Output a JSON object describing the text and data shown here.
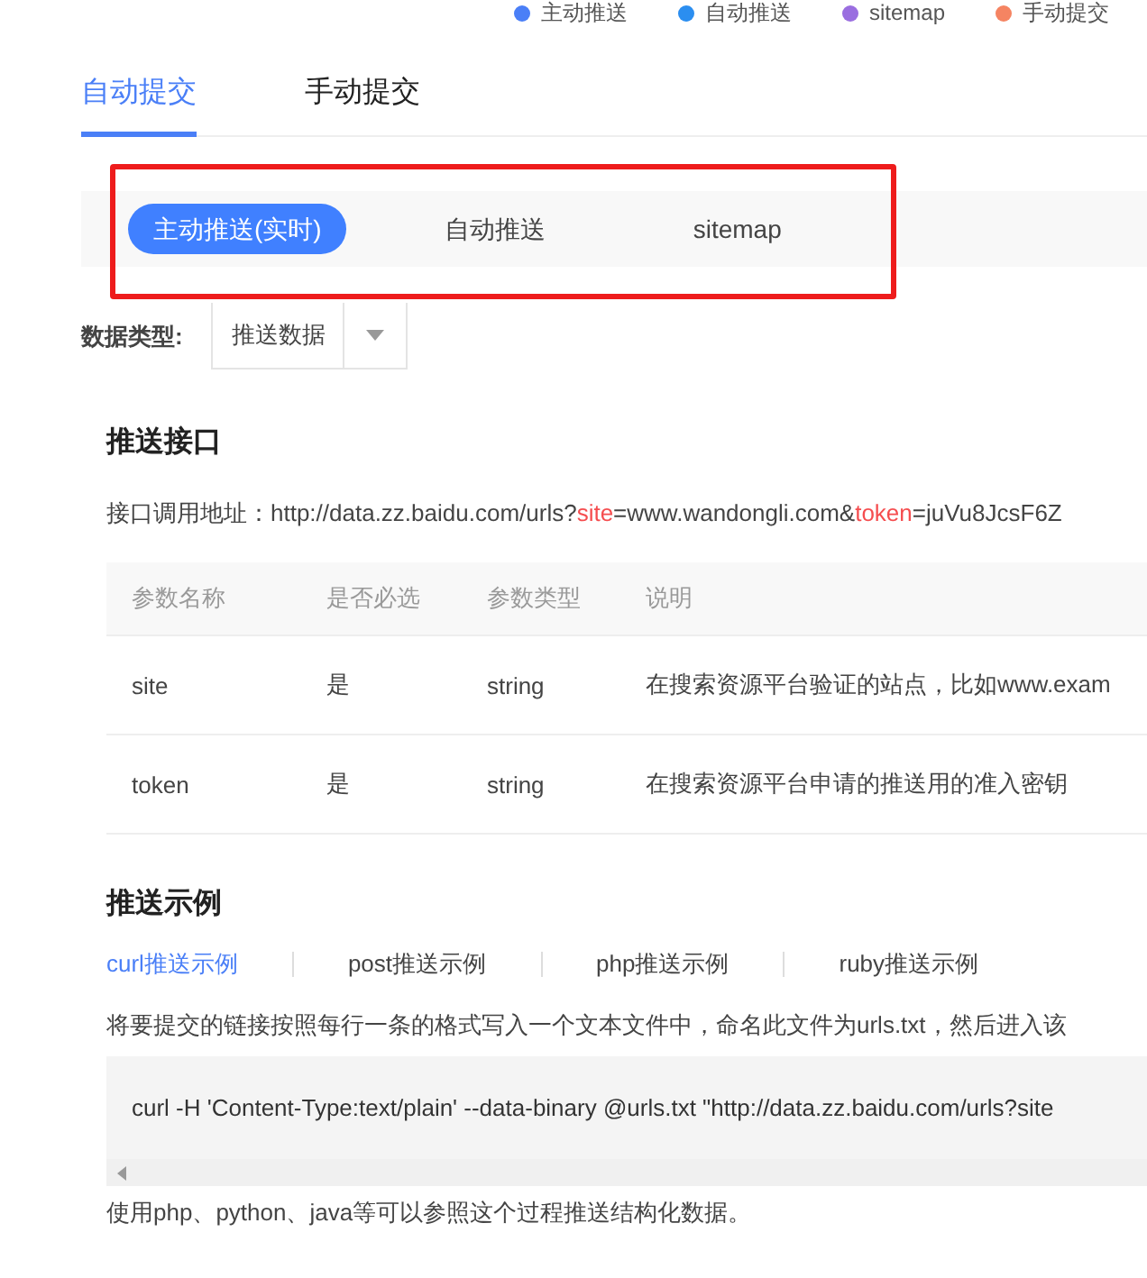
{
  "legend": [
    {
      "label": "主动推送",
      "color": "#4a7ff7"
    },
    {
      "label": "自动推送",
      "color": "#2b8ef0"
    },
    {
      "label": "sitemap",
      "color": "#9a6ee0"
    },
    {
      "label": "手动提交",
      "color": "#f58462"
    }
  ],
  "tabs": [
    {
      "label": "自动提交",
      "selected": true
    },
    {
      "label": "手动提交",
      "selected": false
    }
  ],
  "push_tabs": [
    {
      "label": "主动推送(实时)",
      "selected": true
    },
    {
      "label": "自动推送",
      "selected": false
    },
    {
      "label": "sitemap",
      "selected": false
    }
  ],
  "data_type": {
    "label": "数据类型:",
    "value": "推送数据"
  },
  "interface": {
    "title": "推送接口",
    "url_label": "接口调用地址：",
    "url_parts": [
      {
        "text": "http://data.zz.baidu.com/urls?",
        "kind": "plain"
      },
      {
        "text": "site",
        "kind": "param"
      },
      {
        "text": "=www.wandongli.com&",
        "kind": "plain"
      },
      {
        "text": "token",
        "kind": "param"
      },
      {
        "text": "=juVu8JcsF6Z",
        "kind": "plain"
      }
    ]
  },
  "table": {
    "columns": [
      "参数名称",
      "是否必选",
      "参数类型",
      "说明"
    ],
    "rows": [
      [
        "site",
        "是",
        "string",
        "在搜索资源平台验证的站点，比如www.exam"
      ],
      [
        "token",
        "是",
        "string",
        "在搜索资源平台申请的推送用的准入密钥"
      ]
    ]
  },
  "examples": {
    "title": "推送示例",
    "tabs": [
      {
        "label": "curl推送示例",
        "selected": true
      },
      {
        "label": "post推送示例",
        "selected": false
      },
      {
        "label": "php推送示例",
        "selected": false
      },
      {
        "label": "ruby推送示例",
        "selected": false
      }
    ],
    "description": "将要提交的链接按照每行一条的格式写入一个文本文件中，命名此文件为urls.txt，然后进入该",
    "code": "curl -H 'Content-Type:text/plain' --data-binary @urls.txt \"http://data.zz.baidu.com/urls?site",
    "footer": "使用php、python、java等可以参照这个过程推送结构化数据。"
  }
}
